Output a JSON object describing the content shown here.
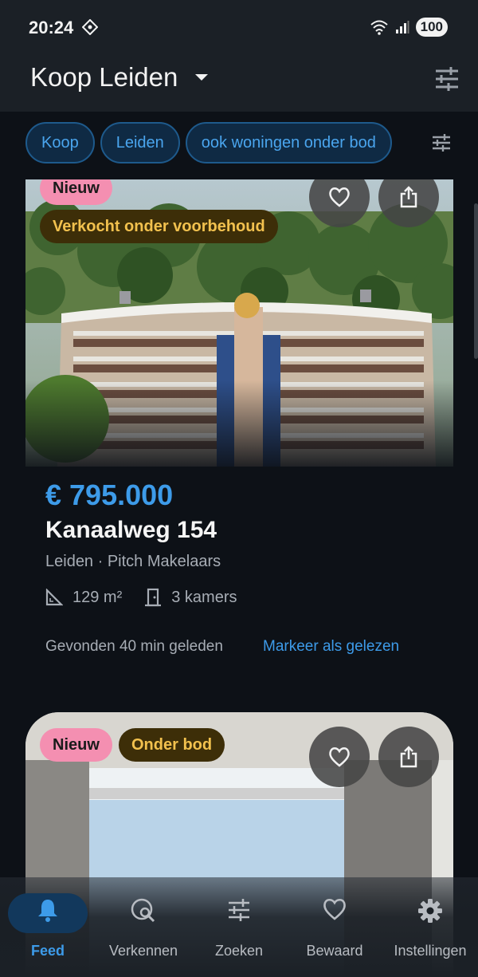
{
  "status_bar": {
    "time": "20:24",
    "battery": "100"
  },
  "app_bar": {
    "title": "Koop Leiden"
  },
  "filters": {
    "chips": [
      "Koop",
      "Leiden",
      "ook woningen onder bod"
    ]
  },
  "listings": [
    {
      "badges": [
        "Nieuw",
        "Verkocht onder voorbehoud"
      ],
      "price": "€ 795.000",
      "address": "Kanaalweg 154",
      "subline": "Leiden · Pitch Makelaars",
      "area": "129 m²",
      "rooms": "3 kamers",
      "found": "Gevonden 40 min geleden",
      "mark_read": "Markeer als gelezen"
    },
    {
      "badges": [
        "Nieuw",
        "Onder bod"
      ]
    }
  ],
  "bottom_nav": {
    "items": [
      {
        "label": "Feed",
        "icon": "bell-icon",
        "active": true
      },
      {
        "label": "Verkennen",
        "icon": "explore-search-icon",
        "active": false
      },
      {
        "label": "Zoeken",
        "icon": "tune-icon",
        "active": false
      },
      {
        "label": "Bewaard",
        "icon": "heart-icon",
        "active": false
      },
      {
        "label": "Instellingen",
        "icon": "gear-icon",
        "active": false
      }
    ]
  },
  "colors": {
    "background": "#0d1117",
    "accent": "#3d9be9",
    "badge_new": "#f48fb1",
    "badge_status_bg": "#3d2e08",
    "badge_status_text": "#f2c14e"
  }
}
